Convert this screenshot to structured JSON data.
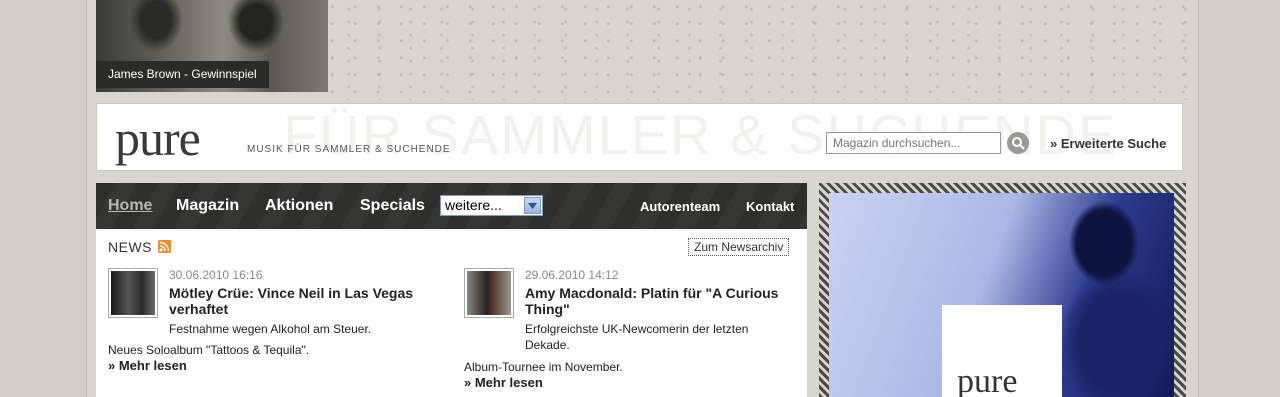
{
  "teaser": {
    "caption": "James Brown - Gewinnspiel"
  },
  "header": {
    "logo": "pure",
    "tagline": "MUSIK FÜR SAMMLER & SUCHENDE",
    "background_text": "FÜR SAMMLER & SUCHENDE",
    "search_placeholder": "Magazin durchsuchen...",
    "advanced_search": "» Erweiterte Suche"
  },
  "nav": {
    "items": [
      {
        "label": "Home",
        "active": true
      },
      {
        "label": "Magazin"
      },
      {
        "label": "Aktionen"
      },
      {
        "label": "Specials"
      }
    ],
    "select_value": "weitere...",
    "right": [
      "Autorenteam",
      "Kontakt"
    ]
  },
  "news": {
    "title": "NEWS",
    "archive_link": "Zum Newsarchiv",
    "items": [
      {
        "date": "30.06.2010 16:16",
        "headline": "Mötley Crüe: Vince Neil in Las Vegas verhaftet",
        "teaser": "Festnahme wegen Alkohol am Steuer.",
        "lead": "Neues Soloalbum \"Tattoos & Tequila\".",
        "more": "» Mehr lesen"
      },
      {
        "date": "29.06.2010 14:12",
        "headline": "Amy Macdonald: Platin für \"A Curious Thing\"",
        "teaser": "Erfolgreichste UK-Newcomerin der letzten Dekade.",
        "lead": "Album-Tournee im November.",
        "more": "» Mehr lesen"
      }
    ]
  },
  "promo": {
    "logo": "pure"
  },
  "colors": {
    "nav_bg": "#2e2e2c",
    "page_bg": "#d6d6cf",
    "rss": "#f08a24"
  }
}
